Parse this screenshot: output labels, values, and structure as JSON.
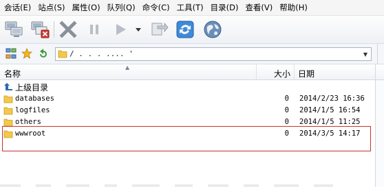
{
  "menu": [
    "会话(E)",
    "站点(S)",
    "属性(O)",
    "队列(Q)",
    "命令(C)",
    "工具(T)",
    "目录(D)",
    "查看(V)",
    "帮助(H)"
  ],
  "toolbar": {
    "icons": [
      "connect-icon",
      "disconnect-icon",
      "cancel-icon",
      "pause-icon",
      "play-icon",
      "dropdown-icon",
      "transfer-icon",
      "refresh-icon",
      "globe-icon"
    ]
  },
  "address": {
    "path": "/ .  .  .  ....  '",
    "icons": [
      "sitemap-icon",
      "favorites-star-icon",
      "back-arrow-icon"
    ]
  },
  "list": {
    "columns": {
      "name": "名称",
      "size": "大小",
      "date": "日期"
    },
    "up_label": "上级目录",
    "rows": [
      {
        "name": "databases",
        "size": "0",
        "date": "2014/2/23 16:36"
      },
      {
        "name": "logfiles",
        "size": "0",
        "date": "2014/1/5 16:54"
      },
      {
        "name": "others",
        "size": "0",
        "date": "2014/1/5 11:25"
      },
      {
        "name": "wwwroot",
        "size": "0",
        "date": "2014/3/5 14:17"
      }
    ]
  },
  "colors": {
    "folder": "#f2c94c",
    "highlight_border": "#c9302c",
    "accent_blue": "#2b6cb0"
  }
}
